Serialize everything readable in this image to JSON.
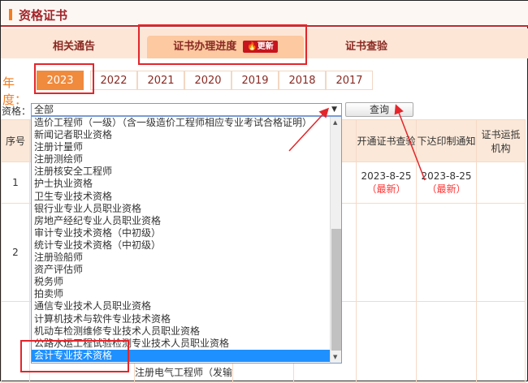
{
  "title": "资格证书",
  "tabs": [
    {
      "label": "相关通告"
    },
    {
      "label": "证书办理进度",
      "badge": "更新"
    },
    {
      "label": "证书查验"
    }
  ],
  "years": {
    "label": "年度：",
    "items": [
      "2023",
      "2022",
      "2021",
      "2020",
      "2019",
      "2018",
      "2017"
    ],
    "selected": "2023"
  },
  "qualification": {
    "label": "资格：",
    "value": "全部",
    "query_label": "查询"
  },
  "dropdown": {
    "options": [
      "造价工程师（一级）（含一级造价工程师相应专业考试合格证明）",
      "新闻记者职业资格",
      "注册计量师",
      "注册测绘师",
      "注册核安全工程师",
      "护士执业资格",
      "卫生专业技术资格",
      "银行业专业人员职业资格",
      "房地产经纪专业人员职业资格",
      "审计专业技术资格（中初级）",
      "统计专业技术资格（中初级）",
      "注册验船师",
      "资产评估师",
      "税务师",
      "拍卖师",
      "通信专业技术人员职业资格",
      "计算机技术与软件专业技术资格",
      "机动车检测维修专业技术人员职业资格",
      "公路水运工程试验检测专业技术人员职业资格",
      "会计专业技术资格"
    ],
    "selected": "会计专业技术资格"
  },
  "table": {
    "headers": [
      "序号",
      "开通证书查验",
      "下达印制通知",
      "证书运抵机构"
    ],
    "rows": [
      {
        "no": "1",
        "open_date": "2023-8-25",
        "open_tag": "（最新）",
        "print_date": "2023-8-25",
        "print_tag": "（最新）"
      },
      {
        "no": "2"
      }
    ],
    "partial_cell": "注册电气工程师（发输"
  },
  "colors": {
    "accent": "#f47c20",
    "brand_red": "#c0272d",
    "annotation": "#e3262b",
    "selection": "#1e90ff"
  }
}
